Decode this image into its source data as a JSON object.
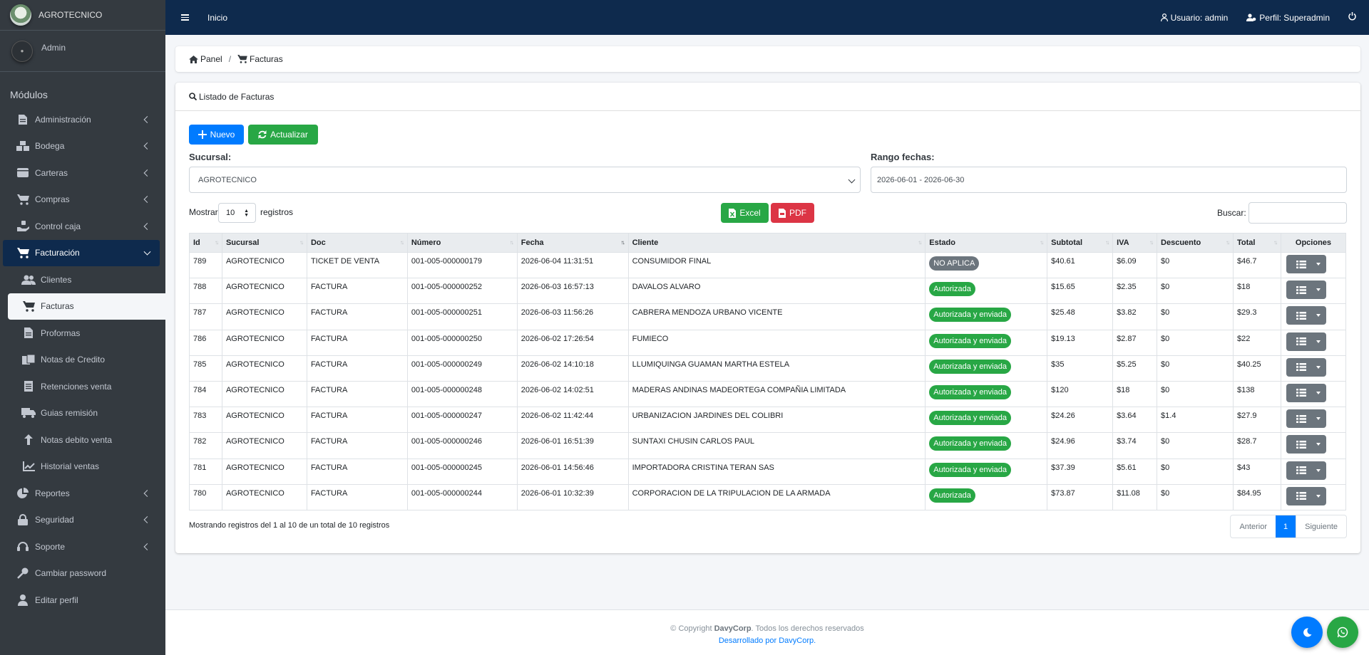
{
  "brand": {
    "name": "AGROTECNICO"
  },
  "user_panel": {
    "name": "Admin"
  },
  "sidebar": {
    "header": "Módulos",
    "items": [
      {
        "label": "Administración",
        "icon": "file-icon"
      },
      {
        "label": "Bodega",
        "icon": "boxes-icon"
      },
      {
        "label": "Carteras",
        "icon": "wallet-icon"
      },
      {
        "label": "Compras",
        "icon": "cart-icon"
      },
      {
        "label": "Control caja",
        "icon": "cash-hand-icon"
      },
      {
        "label": "Facturación",
        "icon": "cart-icon"
      }
    ],
    "sub_items": [
      {
        "label": "Clientes",
        "icon": "users-icon"
      },
      {
        "label": "Facturas",
        "icon": "cart-icon"
      },
      {
        "label": "Proformas",
        "icon": "document-icon"
      },
      {
        "label": "Notas de Credito",
        "icon": "notes-icon"
      },
      {
        "label": "Retenciones venta",
        "icon": "receipt-icon"
      },
      {
        "label": "Guias remisión",
        "icon": "truck-icon"
      },
      {
        "label": "Notas debito venta",
        "icon": "arrow-up-icon"
      },
      {
        "label": "Historial ventas",
        "icon": "chart-line-icon"
      }
    ],
    "bottom_items": [
      {
        "label": "Reportes",
        "icon": "pie-chart-icon"
      },
      {
        "label": "Seguridad",
        "icon": "lock-icon"
      },
      {
        "label": "Soporte",
        "icon": "headset-icon"
      },
      {
        "label": "Cambiar password",
        "icon": "key-icon"
      },
      {
        "label": "Editar perfil",
        "icon": "user-icon"
      }
    ]
  },
  "topbar": {
    "home": "Inicio",
    "user": "Usuario: admin",
    "profile": "Perfil: Superadmin"
  },
  "breadcrumb": {
    "panel": "Panel",
    "separator": "/",
    "current": "Facturas"
  },
  "card": {
    "title": "Listado de Facturas",
    "new_button": "Nuevo",
    "refresh_button": "Actualizar",
    "branch_label": "Sucursal:",
    "branch_value": "AGROTECNICO",
    "range_label": "Rango fechas:",
    "range_value": "2026-06-01 - 2026-06-30",
    "show_label": "Mostrar",
    "page_length": "10",
    "records_label": "registros",
    "excel_button": "Excel",
    "pdf_button": "PDF",
    "search_label": "Buscar:"
  },
  "table": {
    "columns": [
      "Id",
      "Sucursal",
      "Doc",
      "Número",
      "Fecha",
      "Cliente",
      "Estado",
      "Subtotal",
      "IVA",
      "Descuento",
      "Total",
      "Opciones"
    ],
    "rows": [
      {
        "id": "789",
        "sucursal": "AGROTECNICO",
        "doc": "TICKET DE VENTA",
        "numero": "001-005-000000179",
        "fecha": "2026-06-04 11:31:51",
        "cliente": "CONSUMIDOR FINAL",
        "estado": "NO APLICA",
        "estado_color": "#6c757d",
        "subtotal": "$40.61",
        "iva": "$6.09",
        "descuento": "$0",
        "total": "$46.7"
      },
      {
        "id": "788",
        "sucursal": "AGROTECNICO",
        "doc": "FACTURA",
        "numero": "001-005-000000252",
        "fecha": "2026-06-03 16:57:13",
        "cliente": "DAVALOS ALVARO",
        "estado": "Autorizada",
        "estado_color": "#28a745",
        "subtotal": "$15.65",
        "iva": "$2.35",
        "descuento": "$0",
        "total": "$18"
      },
      {
        "id": "787",
        "sucursal": "AGROTECNICO",
        "doc": "FACTURA",
        "numero": "001-005-000000251",
        "fecha": "2026-06-03 11:56:26",
        "cliente": "CABRERA MENDOZA URBANO VICENTE",
        "estado": "Autorizada y enviada",
        "estado_color": "#28a745",
        "subtotal": "$25.48",
        "iva": "$3.82",
        "descuento": "$0",
        "total": "$29.3"
      },
      {
        "id": "786",
        "sucursal": "AGROTECNICO",
        "doc": "FACTURA",
        "numero": "001-005-000000250",
        "fecha": "2026-06-02 17:26:54",
        "cliente": "FUMIECO",
        "estado": "Autorizada y enviada",
        "estado_color": "#28a745",
        "subtotal": "$19.13",
        "iva": "$2.87",
        "descuento": "$0",
        "total": "$22"
      },
      {
        "id": "785",
        "sucursal": "AGROTECNICO",
        "doc": "FACTURA",
        "numero": "001-005-000000249",
        "fecha": "2026-06-02 14:10:18",
        "cliente": "LLUMIQUINGA GUAMAN MARTHA ESTELA",
        "estado": "Autorizada y enviada",
        "estado_color": "#28a745",
        "subtotal": "$35",
        "iva": "$5.25",
        "descuento": "$0",
        "total": "$40.25"
      },
      {
        "id": "784",
        "sucursal": "AGROTECNICO",
        "doc": "FACTURA",
        "numero": "001-005-000000248",
        "fecha": "2026-06-02 14:02:51",
        "cliente": "MADERAS ANDINAS MADEORTEGA COMPAÑIA LIMITADA",
        "estado": "Autorizada y enviada",
        "estado_color": "#28a745",
        "subtotal": "$120",
        "iva": "$18",
        "descuento": "$0",
        "total": "$138"
      },
      {
        "id": "783",
        "sucursal": "AGROTECNICO",
        "doc": "FACTURA",
        "numero": "001-005-000000247",
        "fecha": "2026-06-02 11:42:44",
        "cliente": "URBANIZACION JARDINES DEL COLIBRI",
        "estado": "Autorizada y enviada",
        "estado_color": "#28a745",
        "subtotal": "$24.26",
        "iva": "$3.64",
        "descuento": "$1.4",
        "total": "$27.9"
      },
      {
        "id": "782",
        "sucursal": "AGROTECNICO",
        "doc": "FACTURA",
        "numero": "001-005-000000246",
        "fecha": "2026-06-01 16:51:39",
        "cliente": "SUNTAXI CHUSIN CARLOS PAUL",
        "estado": "Autorizada y enviada",
        "estado_color": "#28a745",
        "subtotal": "$24.96",
        "iva": "$3.74",
        "descuento": "$0",
        "total": "$28.7"
      },
      {
        "id": "781",
        "sucursal": "AGROTECNICO",
        "doc": "FACTURA",
        "numero": "001-005-000000245",
        "fecha": "2026-06-01 14:56:46",
        "cliente": "IMPORTADORA CRISTINA TERAN SAS",
        "estado": "Autorizada y enviada",
        "estado_color": "#28a745",
        "subtotal": "$37.39",
        "iva": "$5.61",
        "descuento": "$0",
        "total": "$43"
      },
      {
        "id": "780",
        "sucursal": "AGROTECNICO",
        "doc": "FACTURA",
        "numero": "001-005-000000244",
        "fecha": "2026-06-01 10:32:39",
        "cliente": "CORPORACION DE LA TRIPULACION DE LA ARMADA",
        "estado": "Autorizada",
        "estado_color": "#28a745",
        "subtotal": "$73.87",
        "iva": "$11.08",
        "descuento": "$0",
        "total": "$84.95"
      }
    ],
    "info": "Mostrando registros del 1 al 10 de un total de 10 registros"
  },
  "pagination": {
    "previous": "Anterior",
    "current": "1",
    "next": "Siguiente"
  },
  "footer": {
    "copyright_prefix": "© Copyright ",
    "company": "DavyCorp",
    "copyright_suffix": ". Todos los derechos reservados",
    "developed": "Desarrollado por DavyCorp."
  },
  "colors": {
    "navbar": "#0e2a4d",
    "sidebar": "#343a40",
    "primary": "#007bff",
    "success": "#28a745",
    "danger": "#dc3545"
  }
}
